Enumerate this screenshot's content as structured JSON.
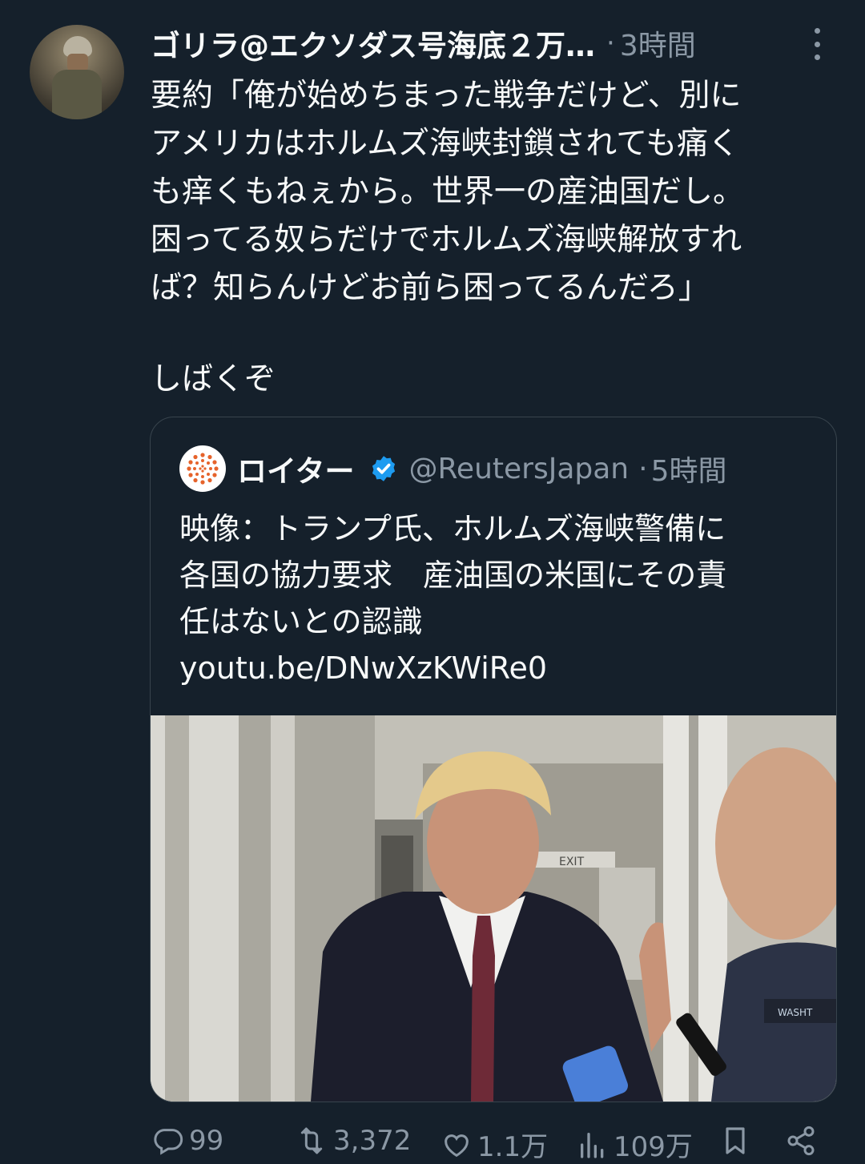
{
  "tweet": {
    "display_name": "ゴリラ@エクソダス号海底２万…",
    "separator": "·",
    "time": "3時間",
    "text_lines": [
      "要約「俺が始めちまった戦争だけど、別に",
      "アメリカはホルムズ海峡封鎖されても痛く",
      "も痒くもねぇから。世界一の産油国だし。",
      "困ってる奴らだけでホルムズ海峡解放すれ",
      "ば？知らんけどお前ら困ってるんだろ」"
    ],
    "text_last": "しばくぞ"
  },
  "quote": {
    "name": "ロイター",
    "handle": "@ReutersJapan",
    "separator": "·",
    "time": "5時間",
    "text_lines": [
      "映像：トランプ氏、ホルムズ海峡警備に",
      "各国の協力要求　産油国の米国にその責",
      "任はないとの認識",
      "youtu.be/DNwXzKWiRe0"
    ],
    "media_labels": {
      "exit_sign": "EXIT",
      "cap_text": "WASHT"
    }
  },
  "actions": {
    "replies": "99",
    "reposts": "3,372",
    "likes": "1.1万",
    "views": "109万"
  },
  "icons": [
    "more-icon",
    "reuters-logo-icon",
    "verified-badge-icon",
    "reply-icon",
    "repost-icon",
    "like-icon",
    "views-icon",
    "bookmark-icon",
    "share-icon"
  ],
  "colors": {
    "background": "#15202b",
    "text": "#f7f9f9",
    "secondary": "#8b98a5",
    "border": "#38444d",
    "verified": "#1d9bf0",
    "reuters_orange": "#e6632b"
  }
}
